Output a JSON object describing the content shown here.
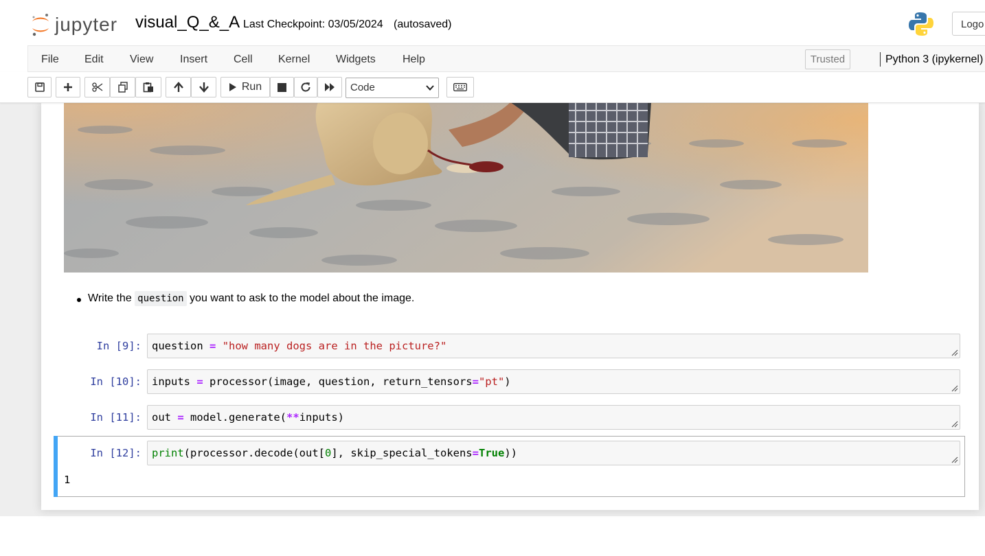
{
  "header": {
    "logo_text": "jupyter",
    "notebook_name": "visual_Q_&_A",
    "checkpoint": "Last Checkpoint: 03/05/2024",
    "autosave": "(autosaved)",
    "logout_label": "Logo"
  },
  "menubar": {
    "items": [
      "File",
      "Edit",
      "View",
      "Insert",
      "Cell",
      "Kernel",
      "Widgets",
      "Help"
    ],
    "trusted_label": "Trusted",
    "kernel_name": "Python 3 (ipykernel)"
  },
  "toolbar": {
    "buttons": [
      "save-icon",
      "plus-icon",
      "cut-icon",
      "copy-icon",
      "paste-icon",
      "arrow-up-icon",
      "arrow-down-icon",
      "play-icon",
      "stop-icon",
      "restart-icon",
      "fast-forward-icon",
      "keyboard-icon"
    ],
    "run_label": "Run",
    "cell_type": "Code"
  },
  "notebook": {
    "markdown": {
      "before": "Write the ",
      "code": "question",
      "after": " you want to ask to the model about the image."
    },
    "cells": [
      {
        "prompt": "In [9]:",
        "code": "question = \"how many dogs are in the picture?\""
      },
      {
        "prompt": "In [10]:",
        "code": "inputs = processor(image, question, return_tensors=\"pt\")"
      },
      {
        "prompt": "In [11]:",
        "code": "out = model.generate(**inputs)"
      },
      {
        "prompt": "In [12]:",
        "code": "print(processor.decode(out[0], skip_special_tokens=True))",
        "output": "1"
      }
    ]
  },
  "colors": {
    "prompt": "#303f9f",
    "selected_cell_bar": "#42a5f5",
    "string": "#ba2121",
    "operator": "#aa22ff",
    "builtin": "#008000"
  }
}
